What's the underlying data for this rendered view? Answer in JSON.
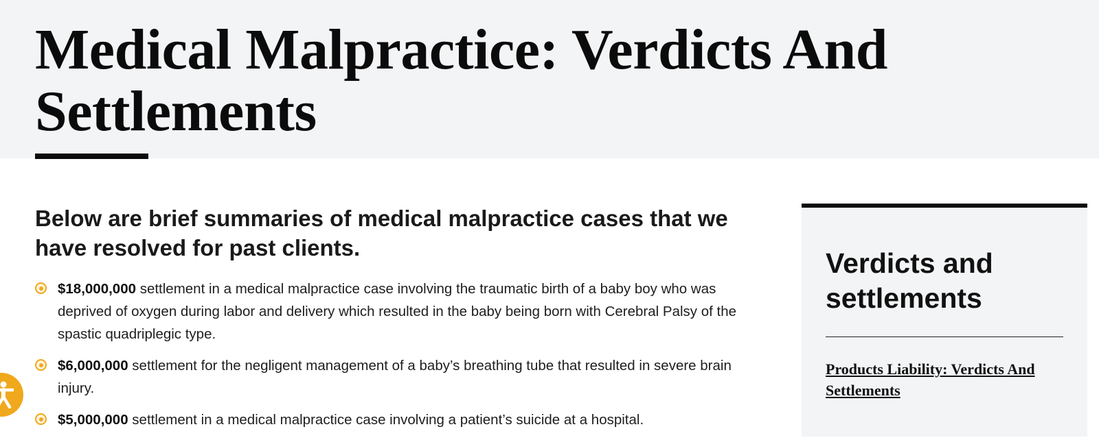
{
  "page": {
    "title": "Medical Malpractice: Verdicts And Settlements"
  },
  "intro": "Below are brief summaries of medical malpractice cases that we have resolved for past clients.",
  "cases": [
    {
      "amount": "$18,000,000",
      "text": " settlement in a medical malpractice case involving the traumatic birth of a baby boy who was deprived of oxygen during labor and delivery which resulted in the baby being born with Cerebral Palsy of the spastic quadriplegic type."
    },
    {
      "amount": "$6,000,000",
      "text": " settlement for the negligent management of a baby’s breathing tube that resulted in severe brain injury."
    },
    {
      "amount": "$5,000,000",
      "text": " settlement in a medical malpractice case involving a patient’s suicide at a hospital."
    }
  ],
  "sidebar": {
    "title": "Verdicts and settlements",
    "links": [
      "Products Liability: Verdicts And Settlements"
    ]
  },
  "colors": {
    "accent": "#f0a81c",
    "hero_bg": "#f3f4f6",
    "text": "#141414"
  },
  "icons": {
    "accessibility": "accessibility-icon",
    "bullet": "radio-bullet-icon"
  }
}
